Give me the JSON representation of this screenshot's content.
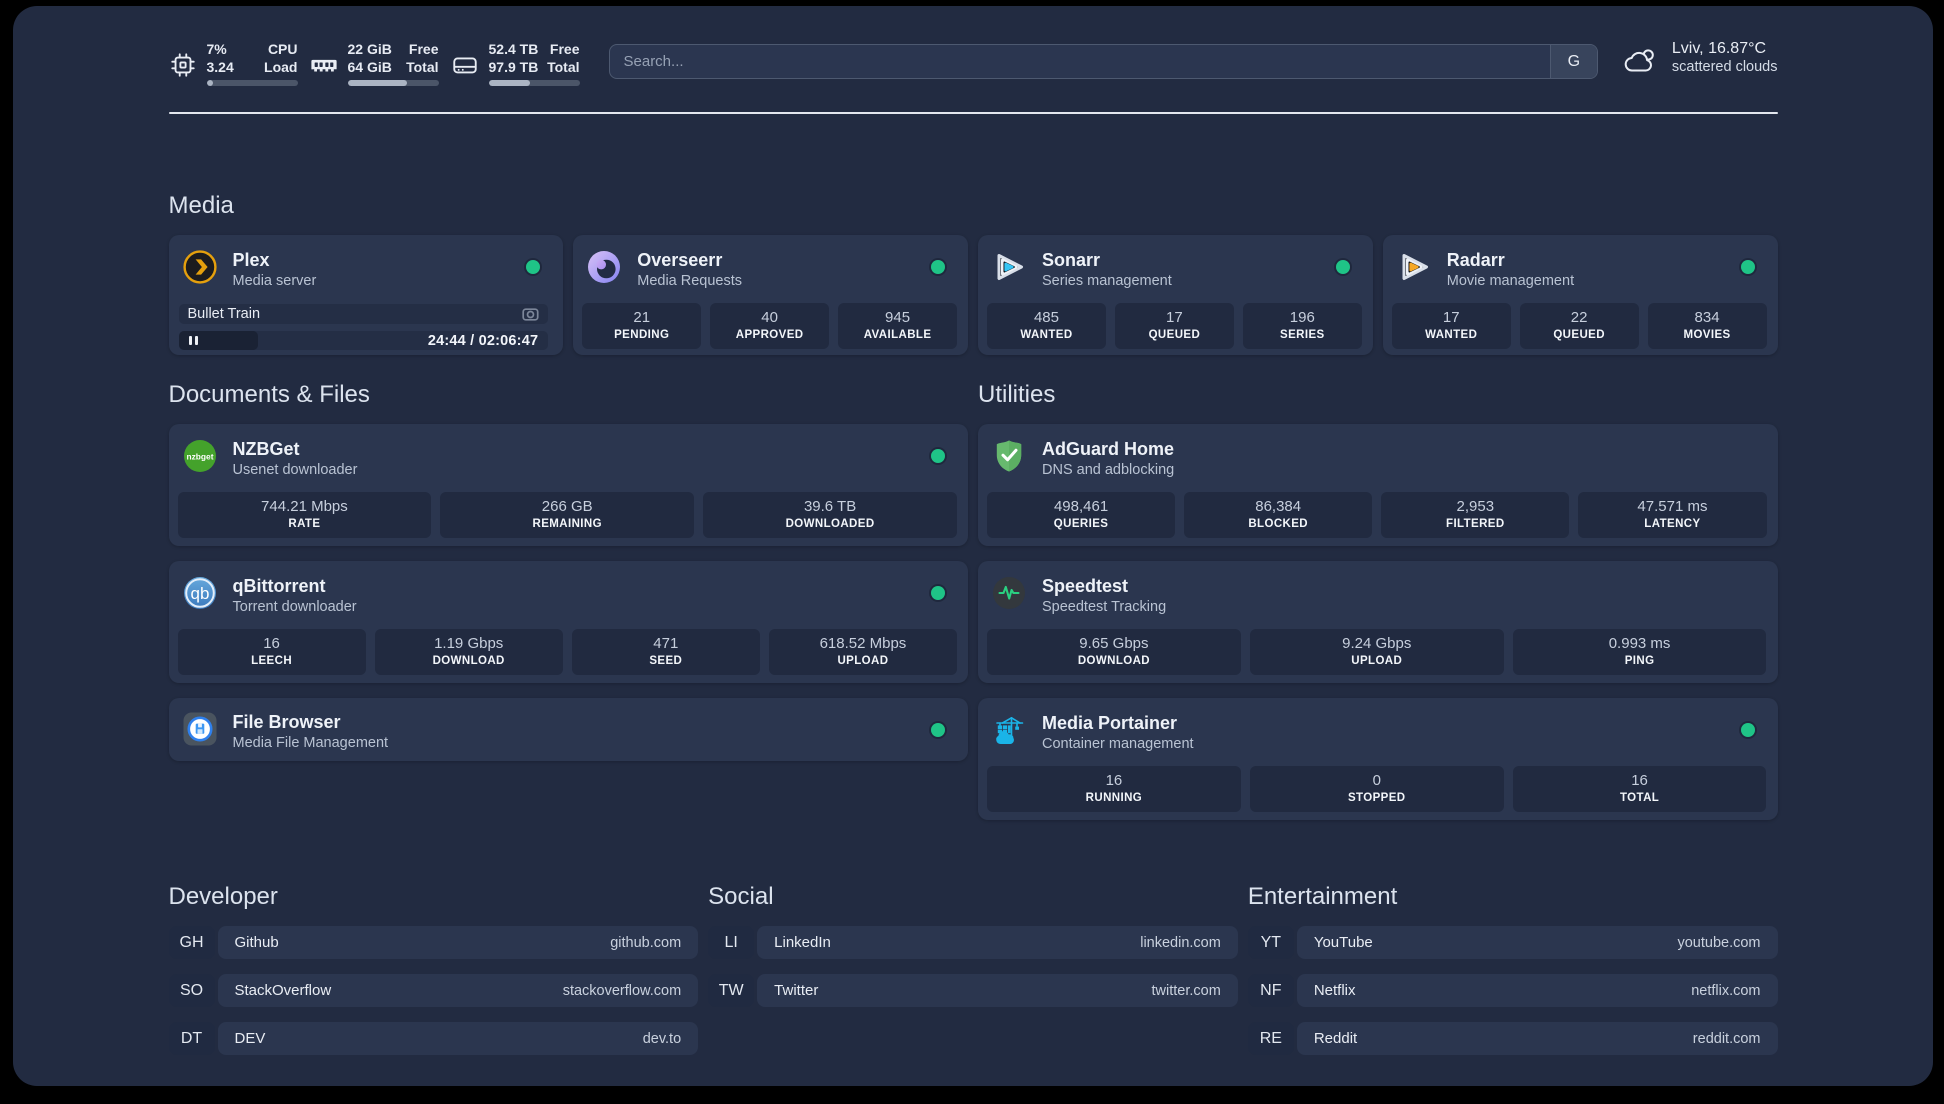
{
  "colors": {
    "background": "#000000",
    "panel": "#222b41",
    "card": "#2b364f",
    "stat_block": "#212a40",
    "status_online": "#1fc487",
    "plex_accent": "#e5a00d",
    "sonarr_accent": "#35c5f4",
    "radarr_accent": "#f7a825",
    "portainer_accent": "#1ab4e8",
    "adguard_accent": "#66bb6a",
    "speedtest_accent": "#2ad181",
    "qbittorrent_accent": "#4c8fce",
    "nzbget_accent": "#44a22b"
  },
  "topbar": {
    "cpu": {
      "value_top": "7%",
      "value_bottom": "3.24",
      "label_top": "CPU",
      "label_bottom": "Load",
      "percent": 7
    },
    "memory": {
      "value_top": "22 GiB",
      "value_bottom": "64 GiB",
      "label_top": "Free",
      "label_bottom": "Total",
      "percent": 65
    },
    "disk": {
      "value_top": "52.4 TB",
      "value_bottom": "97.9 TB",
      "label_top": "Free",
      "label_bottom": "Total",
      "percent": 46
    },
    "search": {
      "placeholder": "Search...",
      "button_label": "G"
    },
    "weather": {
      "location_temperature": "Lviv, 16.87°C",
      "condition": "scattered clouds"
    }
  },
  "sections": {
    "media": {
      "title": "Media",
      "services": [
        {
          "name": "Plex",
          "description": "Media server",
          "status": "online",
          "now_playing": {
            "title": "Bullet Train",
            "time_display": "24:44 / 02:06:47",
            "progress_percent": 21.5
          }
        },
        {
          "name": "Overseerr",
          "description": "Media Requests",
          "status": "online",
          "stats": [
            {
              "value": "21",
              "label": "PENDING"
            },
            {
              "value": "40",
              "label": "APPROVED"
            },
            {
              "value": "945",
              "label": "AVAILABLE"
            }
          ]
        },
        {
          "name": "Sonarr",
          "description": "Series management",
          "status": "online",
          "stats": [
            {
              "value": "485",
              "label": "WANTED"
            },
            {
              "value": "17",
              "label": "QUEUED"
            },
            {
              "value": "196",
              "label": "SERIES"
            }
          ]
        },
        {
          "name": "Radarr",
          "description": "Movie management",
          "status": "online",
          "stats": [
            {
              "value": "17",
              "label": "WANTED"
            },
            {
              "value": "22",
              "label": "QUEUED"
            },
            {
              "value": "834",
              "label": "MOVIES"
            }
          ]
        }
      ]
    },
    "documents": {
      "title": "Documents & Files",
      "services": [
        {
          "name": "NZBGet",
          "description": "Usenet downloader",
          "status": "online",
          "stats": [
            {
              "value": "744.21 Mbps",
              "label": "RATE"
            },
            {
              "value": "266 GB",
              "label": "REMAINING"
            },
            {
              "value": "39.6 TB",
              "label": "DOWNLOADED"
            }
          ]
        },
        {
          "name": "qBittorrent",
          "description": "Torrent downloader",
          "status": "online",
          "stats": [
            {
              "value": "16",
              "label": "LEECH"
            },
            {
              "value": "1.19 Gbps",
              "label": "DOWNLOAD"
            },
            {
              "value": "471",
              "label": "SEED"
            },
            {
              "value": "618.52 Mbps",
              "label": "UPLOAD"
            }
          ]
        },
        {
          "name": "File Browser",
          "description": "Media File Management",
          "status": "online"
        }
      ]
    },
    "utilities": {
      "title": "Utilities",
      "services": [
        {
          "name": "AdGuard Home",
          "description": "DNS and adblocking",
          "stats": [
            {
              "value": "498,461",
              "label": "QUERIES"
            },
            {
              "value": "86,384",
              "label": "BLOCKED"
            },
            {
              "value": "2,953",
              "label": "FILTERED"
            },
            {
              "value": "47.571 ms",
              "label": "LATENCY"
            }
          ]
        },
        {
          "name": "Speedtest",
          "description": "Speedtest Tracking",
          "stats": [
            {
              "value": "9.65 Gbps",
              "label": "DOWNLOAD"
            },
            {
              "value": "9.24 Gbps",
              "label": "UPLOAD"
            },
            {
              "value": "0.993 ms",
              "label": "PING"
            }
          ]
        },
        {
          "name": "Media Portainer",
          "description": "Container management",
          "status": "online",
          "stats": [
            {
              "value": "16",
              "label": "RUNNING"
            },
            {
              "value": "0",
              "label": "STOPPED"
            },
            {
              "value": "16",
              "label": "TOTAL"
            }
          ]
        }
      ]
    },
    "bookmarks": [
      {
        "title": "Developer",
        "items": [
          {
            "abbr": "GH",
            "name": "Github",
            "domain": "github.com"
          },
          {
            "abbr": "SO",
            "name": "StackOverflow",
            "domain": "stackoverflow.com"
          },
          {
            "abbr": "DT",
            "name": "DEV",
            "domain": "dev.to"
          }
        ]
      },
      {
        "title": "Social",
        "items": [
          {
            "abbr": "LI",
            "name": "LinkedIn",
            "domain": "linkedin.com"
          },
          {
            "abbr": "TW",
            "name": "Twitter",
            "domain": "twitter.com"
          }
        ]
      },
      {
        "title": "Entertainment",
        "items": [
          {
            "abbr": "YT",
            "name": "YouTube",
            "domain": "youtube.com"
          },
          {
            "abbr": "NF",
            "name": "Netflix",
            "domain": "netflix.com"
          },
          {
            "abbr": "RE",
            "name": "Reddit",
            "domain": "reddit.com"
          }
        ]
      }
    ]
  }
}
